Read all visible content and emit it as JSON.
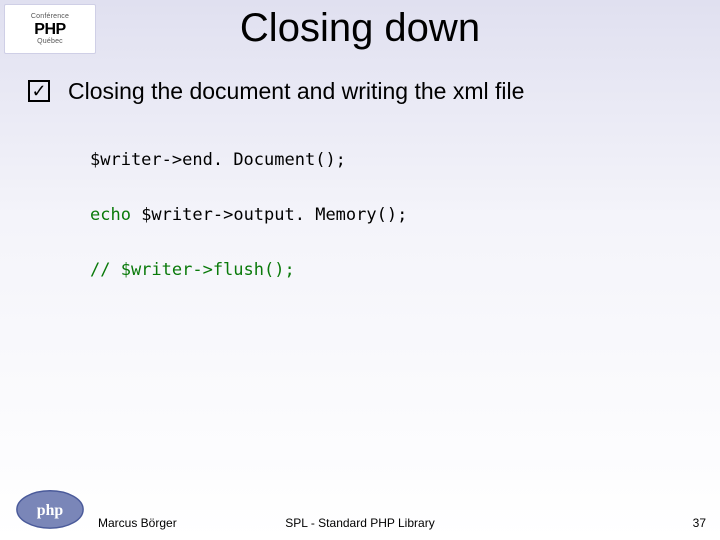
{
  "corner_logo": {
    "line1": "Conférence",
    "line2": "PHP",
    "sub": "Québec"
  },
  "title": "Closing down",
  "bullet": {
    "checkmark": "✓",
    "text": "Closing the document and writing the xml file"
  },
  "code": {
    "line1": {
      "a": "$writer",
      "b": "->",
      "c": "end. Document",
      "d": "();"
    },
    "line2": {
      "a": "echo ",
      "b": "$writer",
      "c": "->",
      "d": "output. Memory",
      "e": "();"
    },
    "line3": "// $writer->flush();"
  },
  "footer": {
    "author": "Marcus Börger",
    "center": "SPL - Standard PHP Library",
    "page": "37"
  },
  "icons": {
    "php_logo_text": "php"
  }
}
